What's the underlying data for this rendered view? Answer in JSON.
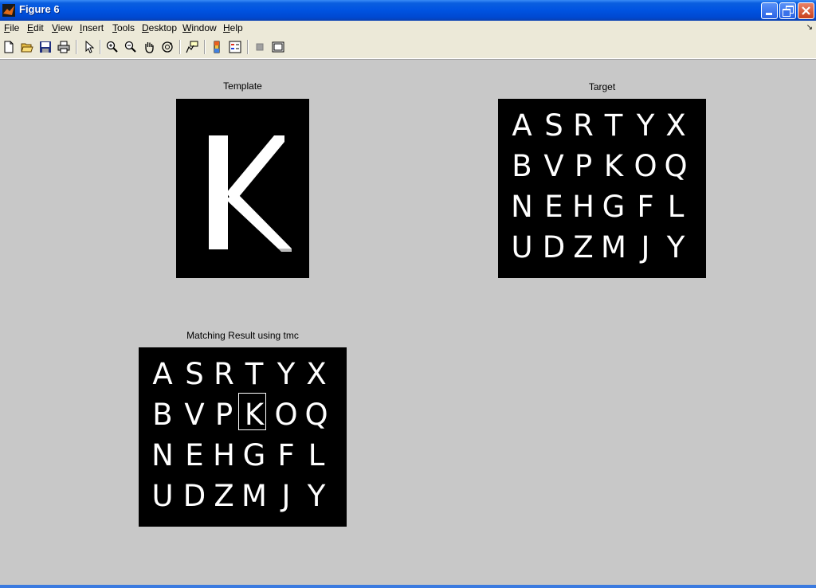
{
  "window": {
    "title": "Figure 6"
  },
  "menu": [
    "File",
    "Edit",
    "View",
    "Insert",
    "Tools",
    "Desktop",
    "Window",
    "Help"
  ],
  "menu_accel": [
    "F",
    "E",
    "V",
    "I",
    "T",
    "D",
    "W",
    "H"
  ],
  "toolbar_icons": [
    "new-file-icon",
    "open-folder-icon",
    "save-icon",
    "print-icon",
    "pointer-icon",
    "zoom-in-icon",
    "zoom-out-icon",
    "pan-icon",
    "rotate-icon",
    "data-cursor-icon",
    "colorbar-icon",
    "legend-icon",
    "hide-tools-icon",
    "dock-icon"
  ],
  "template": {
    "title": "Template",
    "letter": "K"
  },
  "target": {
    "title": "Target",
    "rows": [
      [
        "A",
        "S",
        "R",
        "T",
        "Y",
        "X"
      ],
      [
        "B",
        "V",
        "P",
        "K",
        "O",
        "Q"
      ],
      [
        "N",
        "E",
        "H",
        "G",
        "F",
        "L"
      ],
      [
        "U",
        "D",
        "Z",
        "M",
        "J",
        "Y"
      ]
    ]
  },
  "result": {
    "title": "Matching Result using tmc",
    "rows": [
      [
        "A",
        "S",
        "R",
        "T",
        "Y",
        "X"
      ],
      [
        "B",
        "V",
        "P",
        "K",
        "O",
        "Q"
      ],
      [
        "N",
        "E",
        "H",
        "G",
        "F",
        "L"
      ],
      [
        "U",
        "D",
        "Z",
        "M",
        "J",
        "Y"
      ]
    ],
    "match": {
      "row": 1,
      "col": 3
    }
  },
  "colors": {
    "titlebar": "#0053e1",
    "figure_bg": "#c8c8c8",
    "menubar": "#ece9d8"
  }
}
